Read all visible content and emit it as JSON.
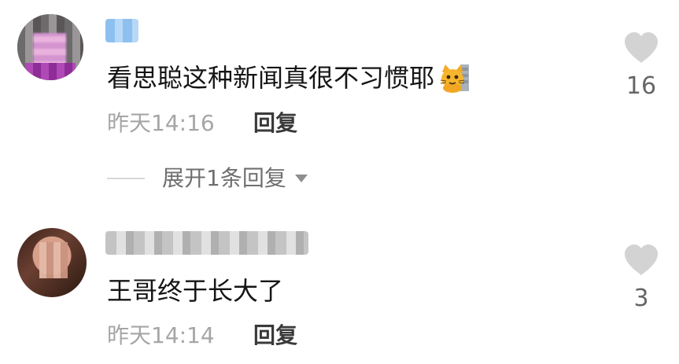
{
  "comments": [
    {
      "text": "看思聪这种新闻真很不习惯耶",
      "emoji": "cat-emoji",
      "time": "昨天14:16",
      "reply_label": "回复",
      "likes": "16",
      "expand_label": "展开1条回复"
    },
    {
      "text": "王哥终于长大了",
      "time": "昨天14:14",
      "reply_label": "回复",
      "likes": "3"
    }
  ],
  "icons": {
    "like": "heart-icon",
    "expand": "caret-down-icon"
  },
  "colors": {
    "text": "#151515",
    "muted": "#a6a6a6",
    "reply": "#3a3a3a",
    "like_icon": "#d3d3d3"
  }
}
